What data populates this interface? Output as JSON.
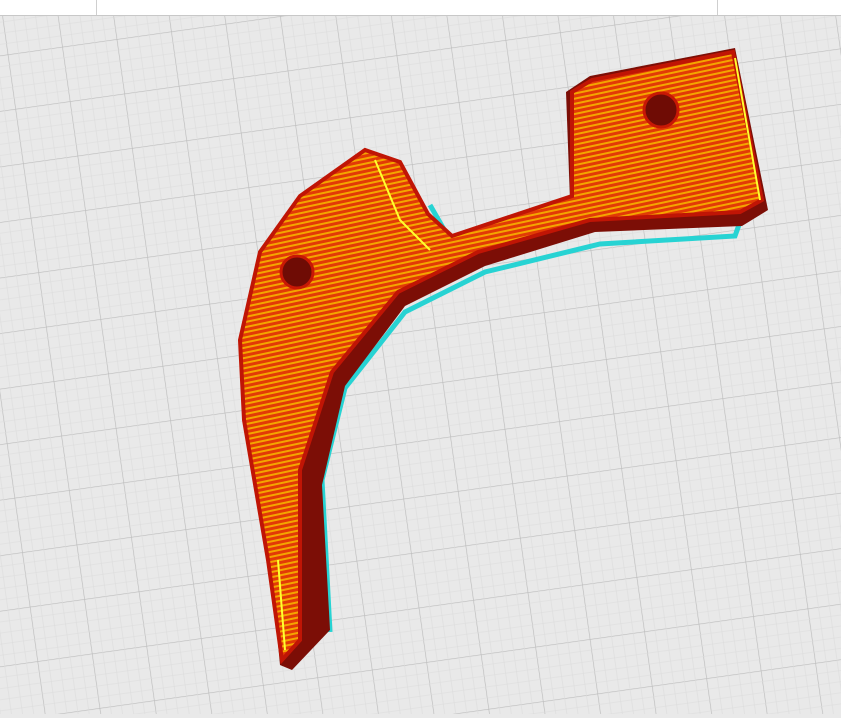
{
  "viewport": {
    "mode": "layer-preview",
    "colors": {
      "build_plate": "#e9e9e9",
      "grid": "#bdbdbd",
      "wall": "#d81c05",
      "wall_shadow": "#7a0d05",
      "infill": "#f2a800",
      "skirt": "#2fd6d6",
      "highlight": "#ffff30"
    }
  }
}
